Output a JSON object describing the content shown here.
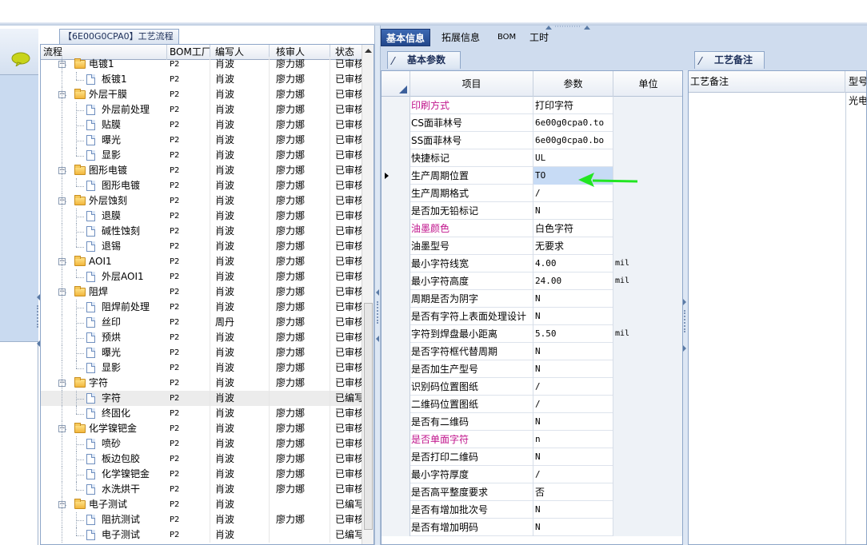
{
  "flow": {
    "title": "【6E00G0CPA0】工艺流程",
    "columns": {
      "flow": "流程",
      "bom_factory": "BOM工厂",
      "writer": "编写人",
      "reviewer": "核审人",
      "status": "状态"
    },
    "rows": [
      {
        "level": 0,
        "name": "电镀1",
        "bom": "P2",
        "writer": "肖波",
        "reviewer": "廖力娜",
        "status": "已审核",
        "expandable": true
      },
      {
        "level": 1,
        "name": "板镀1",
        "bom": "P2",
        "writer": "肖波",
        "reviewer": "廖力娜",
        "status": "已审核"
      },
      {
        "level": 0,
        "name": "外层干膜",
        "bom": "P2",
        "writer": "肖波",
        "reviewer": "廖力娜",
        "status": "已审核",
        "expandable": true
      },
      {
        "level": 1,
        "name": "外层前处理",
        "bom": "P2",
        "writer": "肖波",
        "reviewer": "廖力娜",
        "status": "已审核"
      },
      {
        "level": 1,
        "name": "贴膜",
        "bom": "P2",
        "writer": "肖波",
        "reviewer": "廖力娜",
        "status": "已审核"
      },
      {
        "level": 1,
        "name": "曝光",
        "bom": "P2",
        "writer": "肖波",
        "reviewer": "廖力娜",
        "status": "已审核"
      },
      {
        "level": 1,
        "name": "显影",
        "bom": "P2",
        "writer": "肖波",
        "reviewer": "廖力娜",
        "status": "已审核"
      },
      {
        "level": 0,
        "name": "图形电镀",
        "bom": "P2",
        "writer": "肖波",
        "reviewer": "廖力娜",
        "status": "已审核",
        "expandable": true
      },
      {
        "level": 1,
        "name": "图形电镀",
        "bom": "P2",
        "writer": "肖波",
        "reviewer": "廖力娜",
        "status": "已审核"
      },
      {
        "level": 0,
        "name": "外层蚀刻",
        "bom": "P2",
        "writer": "肖波",
        "reviewer": "廖力娜",
        "status": "已审核",
        "expandable": true
      },
      {
        "level": 1,
        "name": "退膜",
        "bom": "P2",
        "writer": "肖波",
        "reviewer": "廖力娜",
        "status": "已审核"
      },
      {
        "level": 1,
        "name": "碱性蚀刻",
        "bom": "P2",
        "writer": "肖波",
        "reviewer": "廖力娜",
        "status": "已审核"
      },
      {
        "level": 1,
        "name": "退锡",
        "bom": "P2",
        "writer": "肖波",
        "reviewer": "廖力娜",
        "status": "已审核"
      },
      {
        "level": 0,
        "name": "AOI1",
        "bom": "P2",
        "writer": "肖波",
        "reviewer": "廖力娜",
        "status": "已审核",
        "expandable": true
      },
      {
        "level": 1,
        "name": "外层AOI1",
        "bom": "P2",
        "writer": "肖波",
        "reviewer": "廖力娜",
        "status": "已审核"
      },
      {
        "level": 0,
        "name": "阻焊",
        "bom": "P2",
        "writer": "肖波",
        "reviewer": "廖力娜",
        "status": "已审核",
        "expandable": true
      },
      {
        "level": 1,
        "name": "阻焊前处理",
        "bom": "P2",
        "writer": "肖波",
        "reviewer": "廖力娜",
        "status": "已审核"
      },
      {
        "level": 1,
        "name": "丝印",
        "bom": "P2",
        "writer": "周丹",
        "reviewer": "廖力娜",
        "status": "已审核"
      },
      {
        "level": 1,
        "name": "预烘",
        "bom": "P2",
        "writer": "肖波",
        "reviewer": "廖力娜",
        "status": "已审核"
      },
      {
        "level": 1,
        "name": "曝光",
        "bom": "P2",
        "writer": "肖波",
        "reviewer": "廖力娜",
        "status": "已审核"
      },
      {
        "level": 1,
        "name": "显影",
        "bom": "P2",
        "writer": "肖波",
        "reviewer": "廖力娜",
        "status": "已审核"
      },
      {
        "level": 0,
        "name": "字符",
        "bom": "P2",
        "writer": "肖波",
        "reviewer": "廖力娜",
        "status": "已审核",
        "expandable": true
      },
      {
        "level": 1,
        "name": "字符",
        "bom": "P2",
        "writer": "肖波",
        "reviewer": "",
        "status": "已编写",
        "selected": true
      },
      {
        "level": 1,
        "name": "终固化",
        "bom": "P2",
        "writer": "肖波",
        "reviewer": "廖力娜",
        "status": "已审核"
      },
      {
        "level": 0,
        "name": "化学镍钯金",
        "bom": "P2",
        "writer": "肖波",
        "reviewer": "廖力娜",
        "status": "已审核",
        "expandable": true
      },
      {
        "level": 1,
        "name": "喷砂",
        "bom": "P2",
        "writer": "肖波",
        "reviewer": "廖力娜",
        "status": "已审核"
      },
      {
        "level": 1,
        "name": "板边包胶",
        "bom": "P2",
        "writer": "肖波",
        "reviewer": "廖力娜",
        "status": "已审核"
      },
      {
        "level": 1,
        "name": "化学镍钯金",
        "bom": "P2",
        "writer": "肖波",
        "reviewer": "廖力娜",
        "status": "已审核"
      },
      {
        "level": 1,
        "name": "水洗烘干",
        "bom": "P2",
        "writer": "肖波",
        "reviewer": "廖力娜",
        "status": "已审核"
      },
      {
        "level": 0,
        "name": "电子测试",
        "bom": "P2",
        "writer": "肖波",
        "reviewer": "",
        "status": "已编写",
        "expandable": true
      },
      {
        "level": 1,
        "name": "阻抗测试",
        "bom": "P2",
        "writer": "肖波",
        "reviewer": "廖力娜",
        "status": "已审核"
      },
      {
        "level": 1,
        "name": "电子测试",
        "bom": "P2",
        "writer": "肖波",
        "reviewer": "",
        "status": "已编写"
      }
    ]
  },
  "tabs": [
    {
      "label": "基本信息",
      "active": true
    },
    {
      "label": "拓展信息",
      "active": false
    },
    {
      "label": "BOM",
      "active": false
    },
    {
      "label": "工时",
      "active": false
    }
  ],
  "basic_params": {
    "tab_label": "基本参数",
    "columns": {
      "item": "项目",
      "param": "参数",
      "unit": "单位"
    },
    "rows": [
      {
        "item": "印刷方式",
        "value": "打印字符",
        "unit": "",
        "highlight": true
      },
      {
        "item": "CS面菲林号",
        "value": "6e00g0cpa0.to",
        "unit": ""
      },
      {
        "item": "SS面菲林号",
        "value": "6e00g0cpa0.bo",
        "unit": ""
      },
      {
        "item": "快捷标记",
        "value": "UL",
        "unit": ""
      },
      {
        "item": "生产周期位置",
        "value": "TO",
        "unit": "",
        "selected": true
      },
      {
        "item": "生产周期格式",
        "value": "/",
        "unit": ""
      },
      {
        "item": "是否加无铅标记",
        "value": "N",
        "unit": ""
      },
      {
        "item": "油墨颜色",
        "value": "白色字符",
        "unit": "",
        "highlight": true
      },
      {
        "item": "油墨型号",
        "value": "无要求",
        "unit": ""
      },
      {
        "item": "最小字符线宽",
        "value": "4.00",
        "unit": "mil"
      },
      {
        "item": "最小字符高度",
        "value": "24.00",
        "unit": "mil"
      },
      {
        "item": "周期是否为阴字",
        "value": "N",
        "unit": ""
      },
      {
        "item": "是否有字符上表面处理设计",
        "value": "N",
        "unit": ""
      },
      {
        "item": "字符到焊盘最小距离",
        "value": "5.50",
        "unit": "mil"
      },
      {
        "item": "是否字符框代替周期",
        "value": "N",
        "unit": ""
      },
      {
        "item": "是否加生产型号",
        "value": "N",
        "unit": ""
      },
      {
        "item": "识别码位置图纸",
        "value": "/",
        "unit": ""
      },
      {
        "item": "二维码位置图纸",
        "value": "/",
        "unit": ""
      },
      {
        "item": "是否有二维码",
        "value": "N",
        "unit": ""
      },
      {
        "item": "是否单面字符",
        "value": "n",
        "unit": "",
        "highlight": true
      },
      {
        "item": "是否打印二维码",
        "value": "N",
        "unit": ""
      },
      {
        "item": "最小字符厚度",
        "value": "/",
        "unit": ""
      },
      {
        "item": "是否高平整度要求",
        "value": "否",
        "unit": ""
      },
      {
        "item": "是否有增加批次号",
        "value": "N",
        "unit": ""
      },
      {
        "item": "是否有增加明码",
        "value": "N",
        "unit": ""
      }
    ]
  },
  "notes": {
    "tab_label": "工艺备注",
    "col1": "工艺备注",
    "col2": "型号",
    "cell": "光电"
  },
  "colors": {
    "highlight_text": "#c0148c",
    "arrow": "#22e622",
    "active_tab": "#2a4f95"
  }
}
